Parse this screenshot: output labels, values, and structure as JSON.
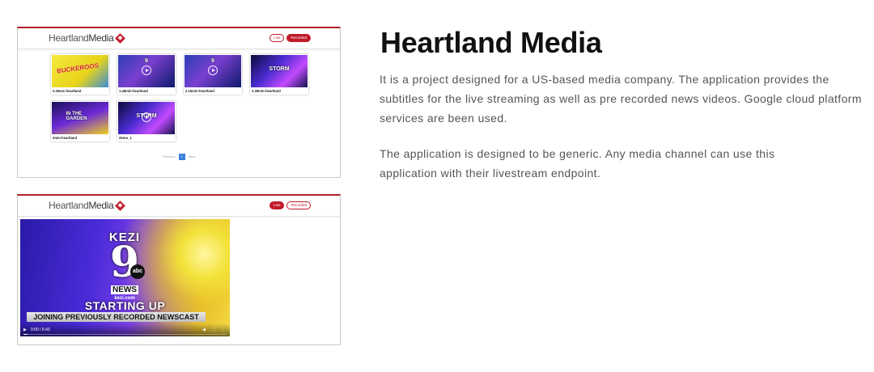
{
  "app": {
    "logo_light": "Heartland",
    "logo_dark": "Media",
    "live_label": "Live",
    "recorded_label": "Recorded"
  },
  "tiles": [
    {
      "title": "0.26sec-heartland",
      "thumb_text": "BUCKEROOS",
      "style": "yellow"
    },
    {
      "title": "1.46min-heartland",
      "thumb_text": "9",
      "style": "news"
    },
    {
      "title": "2.15min-heartland",
      "thumb_text": "9",
      "style": "news"
    },
    {
      "title": "2.39min-heartland",
      "thumb_text": "STORM",
      "style": "purple"
    },
    {
      "title": "2min-heartland",
      "thumb_text": "IN THE GARDEN",
      "style": "garden"
    },
    {
      "title": "demo_1",
      "thumb_text": "STORM",
      "style": "purple"
    }
  ],
  "pager": {
    "prev": "Previous",
    "page": "1",
    "next": "Next"
  },
  "player": {
    "station": "KEZI",
    "channel": "9",
    "network": "abc",
    "news": "NEWS",
    "url": "kezi.com",
    "banner_main": "STARTING UP",
    "banner_sub": "JOINING PREVIOUSLY RECORDED NEWSCAST",
    "time": "0:00 / 6:43",
    "progress": 0.02
  },
  "article": {
    "title": "Heartland Media",
    "para1": "It is a project designed for a US-based media company. The application provides the subtitles for the live streaming as well as pre recorded news videos. Google cloud platform services are been used.",
    "para2": "The application is designed to be generic. Any media channel can use this application with their livestream endpoint."
  },
  "colors": {
    "brand_red": "#c11b2a",
    "page_blue": "#3b7ddd",
    "text_gray": "#555555"
  }
}
